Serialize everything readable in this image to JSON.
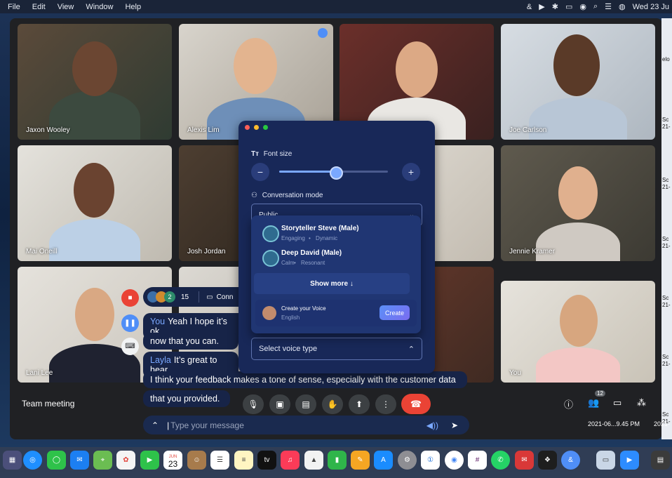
{
  "menubar": {
    "items": [
      "File",
      "Edit",
      "View",
      "Window",
      "Help"
    ],
    "clock": "Wed 23 Ju"
  },
  "meeting": {
    "title": "Team meeting",
    "participants": [
      {
        "name": "Jaxon Wooley"
      },
      {
        "name": "Alexis Lim"
      },
      {
        "name": ""
      },
      {
        "name": "Joe Carlson"
      },
      {
        "name": "Mai Oneill"
      },
      {
        "name": "Josh Jordan"
      },
      {
        "name": ""
      },
      {
        "name": "Jennie Kramer"
      },
      {
        "name": "Lani Lee"
      },
      {
        "name": ""
      },
      {
        "name": ""
      },
      {
        "name": "You"
      }
    ],
    "participant_badge": "12"
  },
  "caption_bar": {
    "count_avatar": "2",
    "count": "15",
    "connect_label": "Conn"
  },
  "chat": {
    "messages": [
      {
        "who": "You",
        "text": "Yeah I hope it’s ok"
      },
      {
        "who": "",
        "text": "now that you can."
      },
      {
        "who": "Layla",
        "text": "It’s great to hear"
      },
      {
        "who": "",
        "text": "I think your feedback makes a tone of sense, especially with the customer data"
      },
      {
        "who": "",
        "text": "that you provided."
      }
    ],
    "input_placeholder": "Type your message",
    "input_value": "|"
  },
  "settings_panel": {
    "font_size_label": "Font size",
    "font_size_level": 0.52,
    "conversation_mode_label": "Conversation mode",
    "conversation_mode_value": "Public",
    "voices": [
      {
        "name": "Storyteller Steve (Male)",
        "tag1": "Engaging",
        "tag2": "Dynamic"
      },
      {
        "name": "Deep David (Male)",
        "tag1": "Calm",
        "tag2": "Resonant"
      }
    ],
    "show_more_label": "Show more ↓",
    "create_title": "Create your Voice",
    "create_language": "English",
    "create_button": "Create",
    "voice_type_placeholder": "Select voice type"
  },
  "right_strip": {
    "labels": [
      "elo",
      "Sc",
      "21-",
      "Sc",
      "21-",
      "Sc",
      "21-",
      "Sc",
      "21-",
      "Sc",
      "21-",
      "Sc",
      "21-",
      "Sc",
      "21-"
    ]
  },
  "timestamps": [
    "2021-06...9.45 PM",
    "2021-"
  ],
  "dock": {
    "calendar_month": "JUN",
    "calendar_day": "23",
    "tv_label": "tv"
  },
  "colors": {
    "accent": "#4f8ef7",
    "end_call": "#ea4335",
    "panel_bg": "#182858",
    "create_button": "#4f8ef7"
  }
}
